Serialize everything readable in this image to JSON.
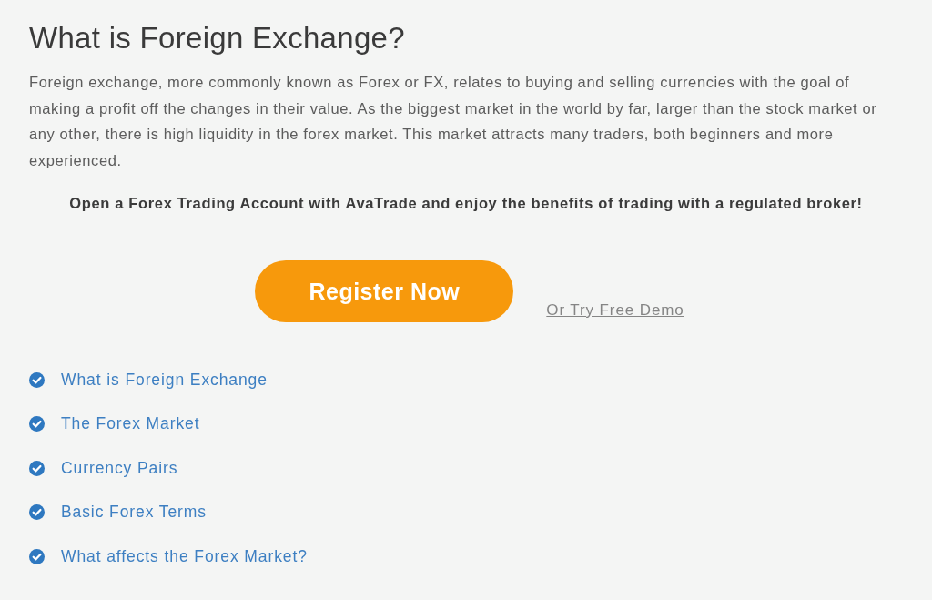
{
  "heading": "What is Foreign Exchange?",
  "intro": "Foreign exchange, more commonly known as Forex or FX, relates to buying and selling currencies with the goal of making a profit off the changes in their value. As the biggest market in the world by far, larger than the stock market or any other, there is high liquidity in the forex market. This market attracts many traders, both beginners and more experienced.",
  "cta_text": "Open a Forex Trading Account with AvaTrade and enjoy the benefits of trading with a regulated broker!",
  "actions": [
    {
      "label": "Register Now",
      "kind": "primary"
    },
    {
      "label": "Or Try Free Demo",
      "kind": "link"
    }
  ],
  "topics": [
    {
      "label": "What is Foreign Exchange",
      "checked": true
    },
    {
      "label": "The Forex Market",
      "checked": true
    },
    {
      "label": "Currency Pairs",
      "checked": true
    },
    {
      "label": "Basic Forex Terms",
      "checked": true
    },
    {
      "label": "What affects the Forex Market?",
      "checked": true
    }
  ]
}
